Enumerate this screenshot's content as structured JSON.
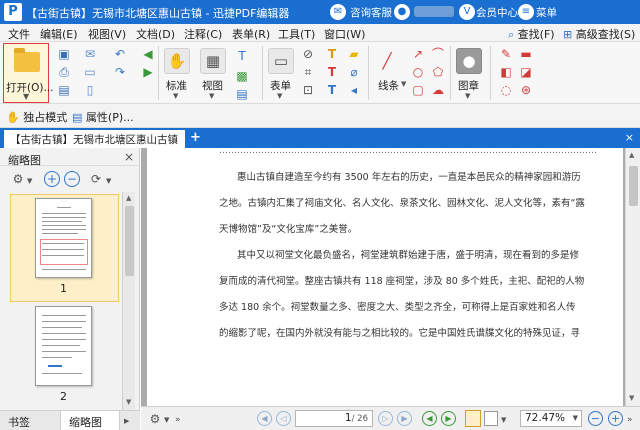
{
  "titlebar": {
    "logo": "P",
    "title": "【古街古镇】无锡市北塘区惠山古镇 - 迅捷PDF编辑器",
    "support_label": "咨询客服",
    "member_label": "会员中心",
    "menu_label": "菜单"
  },
  "menubar": {
    "items": [
      "文件",
      "编辑(E)",
      "视图(V)",
      "文档(D)",
      "注释(C)",
      "表单(R)",
      "工具(T)",
      "窗口(W)"
    ],
    "find_label": "查找(F)",
    "advanced_search_label": "高级查找(S)"
  },
  "ribbon": {
    "open_label": "打开(O)...",
    "standard_label": "标准",
    "view_label": "视图",
    "form_label": "表单",
    "line_label": "线条",
    "stamp_label": "图章"
  },
  "modebar": {
    "exclusive_mode": "独占模式",
    "properties": "属性(P)..."
  },
  "tabs": {
    "doc_tab": "【古街古镇】无锡市北塘区惠山古镇",
    "add_tab": "+",
    "close": "×"
  },
  "left_panel": {
    "title": "缩略图",
    "pages": [
      "1",
      "2"
    ],
    "bottom_tabs": [
      "书签",
      "缩略图"
    ]
  },
  "document": {
    "paragraphs": [
      "惠山古镇自建造至今约有 3500 年左右的历史，一直是本邑民众的精神家园和游历",
      "之地。古镇内汇集了祠庙文化、名人文化、泉茶文化、园林文化、泥人文化等，素有“露",
      "天博物馆”及“文化宝库”之美誉。",
      "其中又以祠堂文化最负盛名，祠堂建筑群始建于唐，盛于明清，现在看到的多是修",
      "复而成的清代祠堂。整座古镇共有 118 座祠堂，涉及 80 多个姓氏，主祀、配祀的人物",
      "多达 180 余个。祠堂数量之多、密度之大、类型之齐全，可称得上是百家姓和名人传",
      "的缩影了呢，在国内外就没有能与之相比较的。它是中国姓氏谱牒文化的特殊见证，寻"
    ]
  },
  "statusbar": {
    "current_page": "1",
    "total_pages": "/ 26",
    "zoom": "72.47%"
  },
  "colors": {
    "accent": "#1b6fd0",
    "open_highlight": "#e23c3c"
  }
}
